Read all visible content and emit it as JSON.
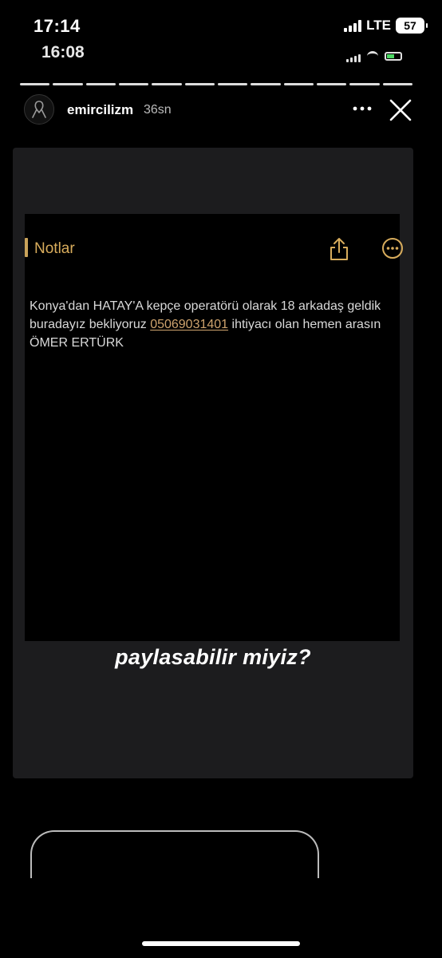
{
  "status_bar": {
    "time": "17:14",
    "network": "LTE",
    "battery": "57"
  },
  "inner_status_bar": {
    "time": "16:08"
  },
  "story": {
    "username": "emircilizm",
    "time_ago": "36sn",
    "segment_count": 12
  },
  "notes_app": {
    "title": "Notlar",
    "note": {
      "text_before": "Konya'dan HATAY'A kepçe operatörü olarak 18 arkadaş geldik buradayız bekliyoruz ",
      "phone": "05069031401",
      "text_after": " ihtiyacı olan hemen arasın ÖMER ERTÜRK"
    }
  },
  "caption": "paylasabilir miyiz?",
  "icons": {
    "avatar": "black-ribbon-icon",
    "more": "more-dots-icon",
    "close": "close-icon",
    "share": "share-icon",
    "notes_more": "more-circle-icon"
  },
  "colors": {
    "accent_notes": "#d8ac5c",
    "link": "#cfa46e",
    "background": "#000000",
    "card": "#1c1c1e"
  }
}
